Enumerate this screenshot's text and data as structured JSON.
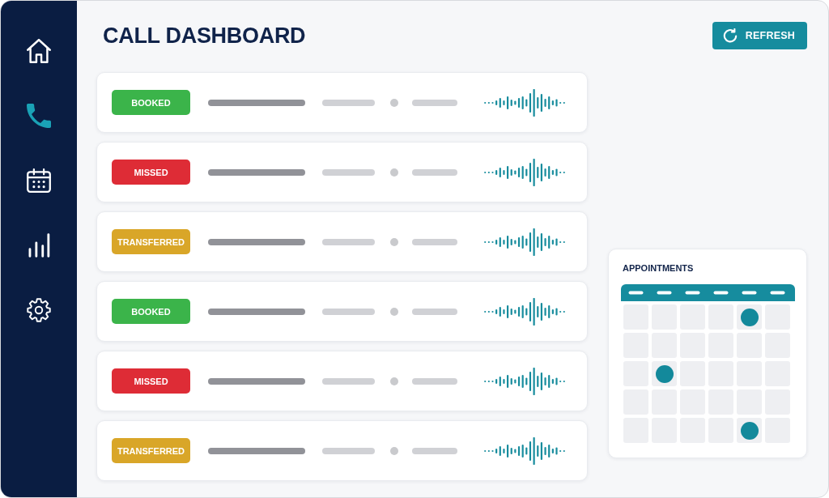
{
  "sidebar": {
    "items": [
      {
        "kind": "home",
        "selected": false
      },
      {
        "kind": "phone",
        "selected": true
      },
      {
        "kind": "calendar",
        "selected": false
      },
      {
        "kind": "chart",
        "selected": false
      },
      {
        "kind": "settings",
        "selected": false
      }
    ]
  },
  "header": {
    "title": "CALL DASHBOARD",
    "refresh_button": "REFRESH"
  },
  "calls": [
    {
      "status": "BOOKED",
      "color": "#3bb44a"
    },
    {
      "status": "MISSED",
      "color": "#de2c36"
    },
    {
      "status": "TRANSFERRED",
      "color": "#d9a628"
    },
    {
      "status": "BOOKED",
      "color": "#3bb44a"
    },
    {
      "status": "MISSED",
      "color": "#de2c36"
    },
    {
      "status": "TRANSFERRED",
      "color": "#d9a628"
    }
  ],
  "appointments": {
    "title": "APPOINTMENTS",
    "weeks": [
      {
        "days": [
          {
            "has_appointment": false
          },
          {
            "has_appointment": false
          },
          {
            "has_appointment": false
          },
          {
            "has_appointment": false
          },
          {
            "has_appointment": true
          },
          {
            "has_appointment": false
          }
        ]
      },
      {
        "days": [
          {
            "has_appointment": false
          },
          {
            "has_appointment": false
          },
          {
            "has_appointment": false
          },
          {
            "has_appointment": false
          },
          {
            "has_appointment": false
          },
          {
            "has_appointment": false
          }
        ]
      },
      {
        "days": [
          {
            "has_appointment": false
          },
          {
            "has_appointment": true
          },
          {
            "has_appointment": false
          },
          {
            "has_appointment": false
          },
          {
            "has_appointment": false
          },
          {
            "has_appointment": false
          }
        ]
      },
      {
        "days": [
          {
            "has_appointment": false
          },
          {
            "has_appointment": false
          },
          {
            "has_appointment": false
          },
          {
            "has_appointment": false
          },
          {
            "has_appointment": false
          },
          {
            "has_appointment": false
          }
        ]
      },
      {
        "days": [
          {
            "has_appointment": false
          },
          {
            "has_appointment": false
          },
          {
            "has_appointment": false
          },
          {
            "has_appointment": false
          },
          {
            "has_appointment": true
          },
          {
            "has_appointment": false
          }
        ]
      }
    ]
  }
}
